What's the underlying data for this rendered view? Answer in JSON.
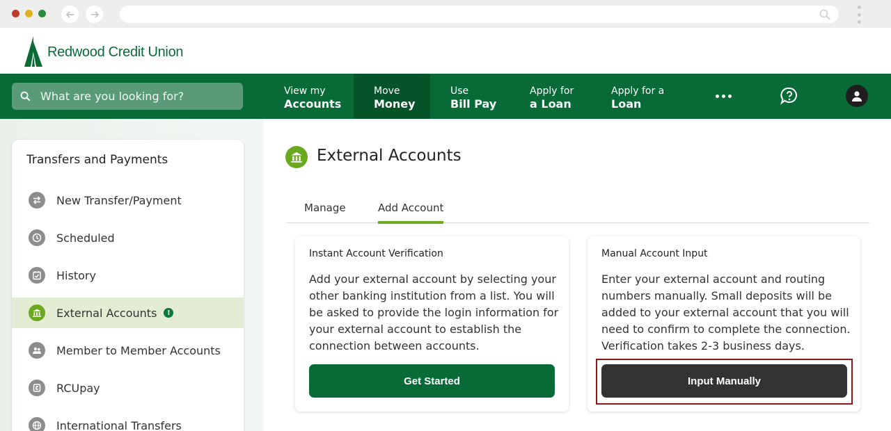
{
  "colors": {
    "brand_green": "#086b37",
    "accent_green": "#6aa820",
    "active_nav": "#045329"
  },
  "logo": {
    "text": "Redwood Credit Union"
  },
  "search": {
    "placeholder": "What are you looking for?"
  },
  "nav": [
    {
      "line1": "View my",
      "line2": "Accounts"
    },
    {
      "line1": "Move",
      "line2": "Money",
      "active": true
    },
    {
      "line1": "Use",
      "line2": "Bill Pay"
    },
    {
      "line1": "Apply for",
      "line2": "a Loan"
    },
    {
      "line1": "Apply for a",
      "line2": "Loan"
    }
  ],
  "sidebar": {
    "title": "Transfers and Payments",
    "items": [
      {
        "label": "New Transfer/Payment",
        "icon": "swap-arrows-icon"
      },
      {
        "label": "Scheduled",
        "icon": "clock-icon"
      },
      {
        "label": "History",
        "icon": "calendar-check-icon"
      },
      {
        "label": "External Accounts",
        "icon": "bank-icon",
        "active": true,
        "alert": "!"
      },
      {
        "label": "Member to Member Accounts",
        "icon": "people-icon"
      },
      {
        "label": "RCUpay",
        "icon": "rcupay-icon"
      },
      {
        "label": "International Transfers",
        "icon": "globe-icon"
      }
    ]
  },
  "main": {
    "title": "External Accounts",
    "tabs": [
      {
        "label": "Manage"
      },
      {
        "label": "Add Account",
        "active": true
      }
    ],
    "cards": [
      {
        "title": "Instant Account Verification",
        "body": "Add your external account by selecting your other banking institution from a list. You will be asked to provide the login information for your external account to establish the connection between accounts.",
        "button": "Get Started"
      },
      {
        "title": "Manual Account Input",
        "body": "Enter your external account and routing numbers manually. Small deposits will be added to your external account that you will need to confirm to complete the connection. Verification takes 2-3 business days.",
        "button": "Input Manually"
      }
    ]
  }
}
